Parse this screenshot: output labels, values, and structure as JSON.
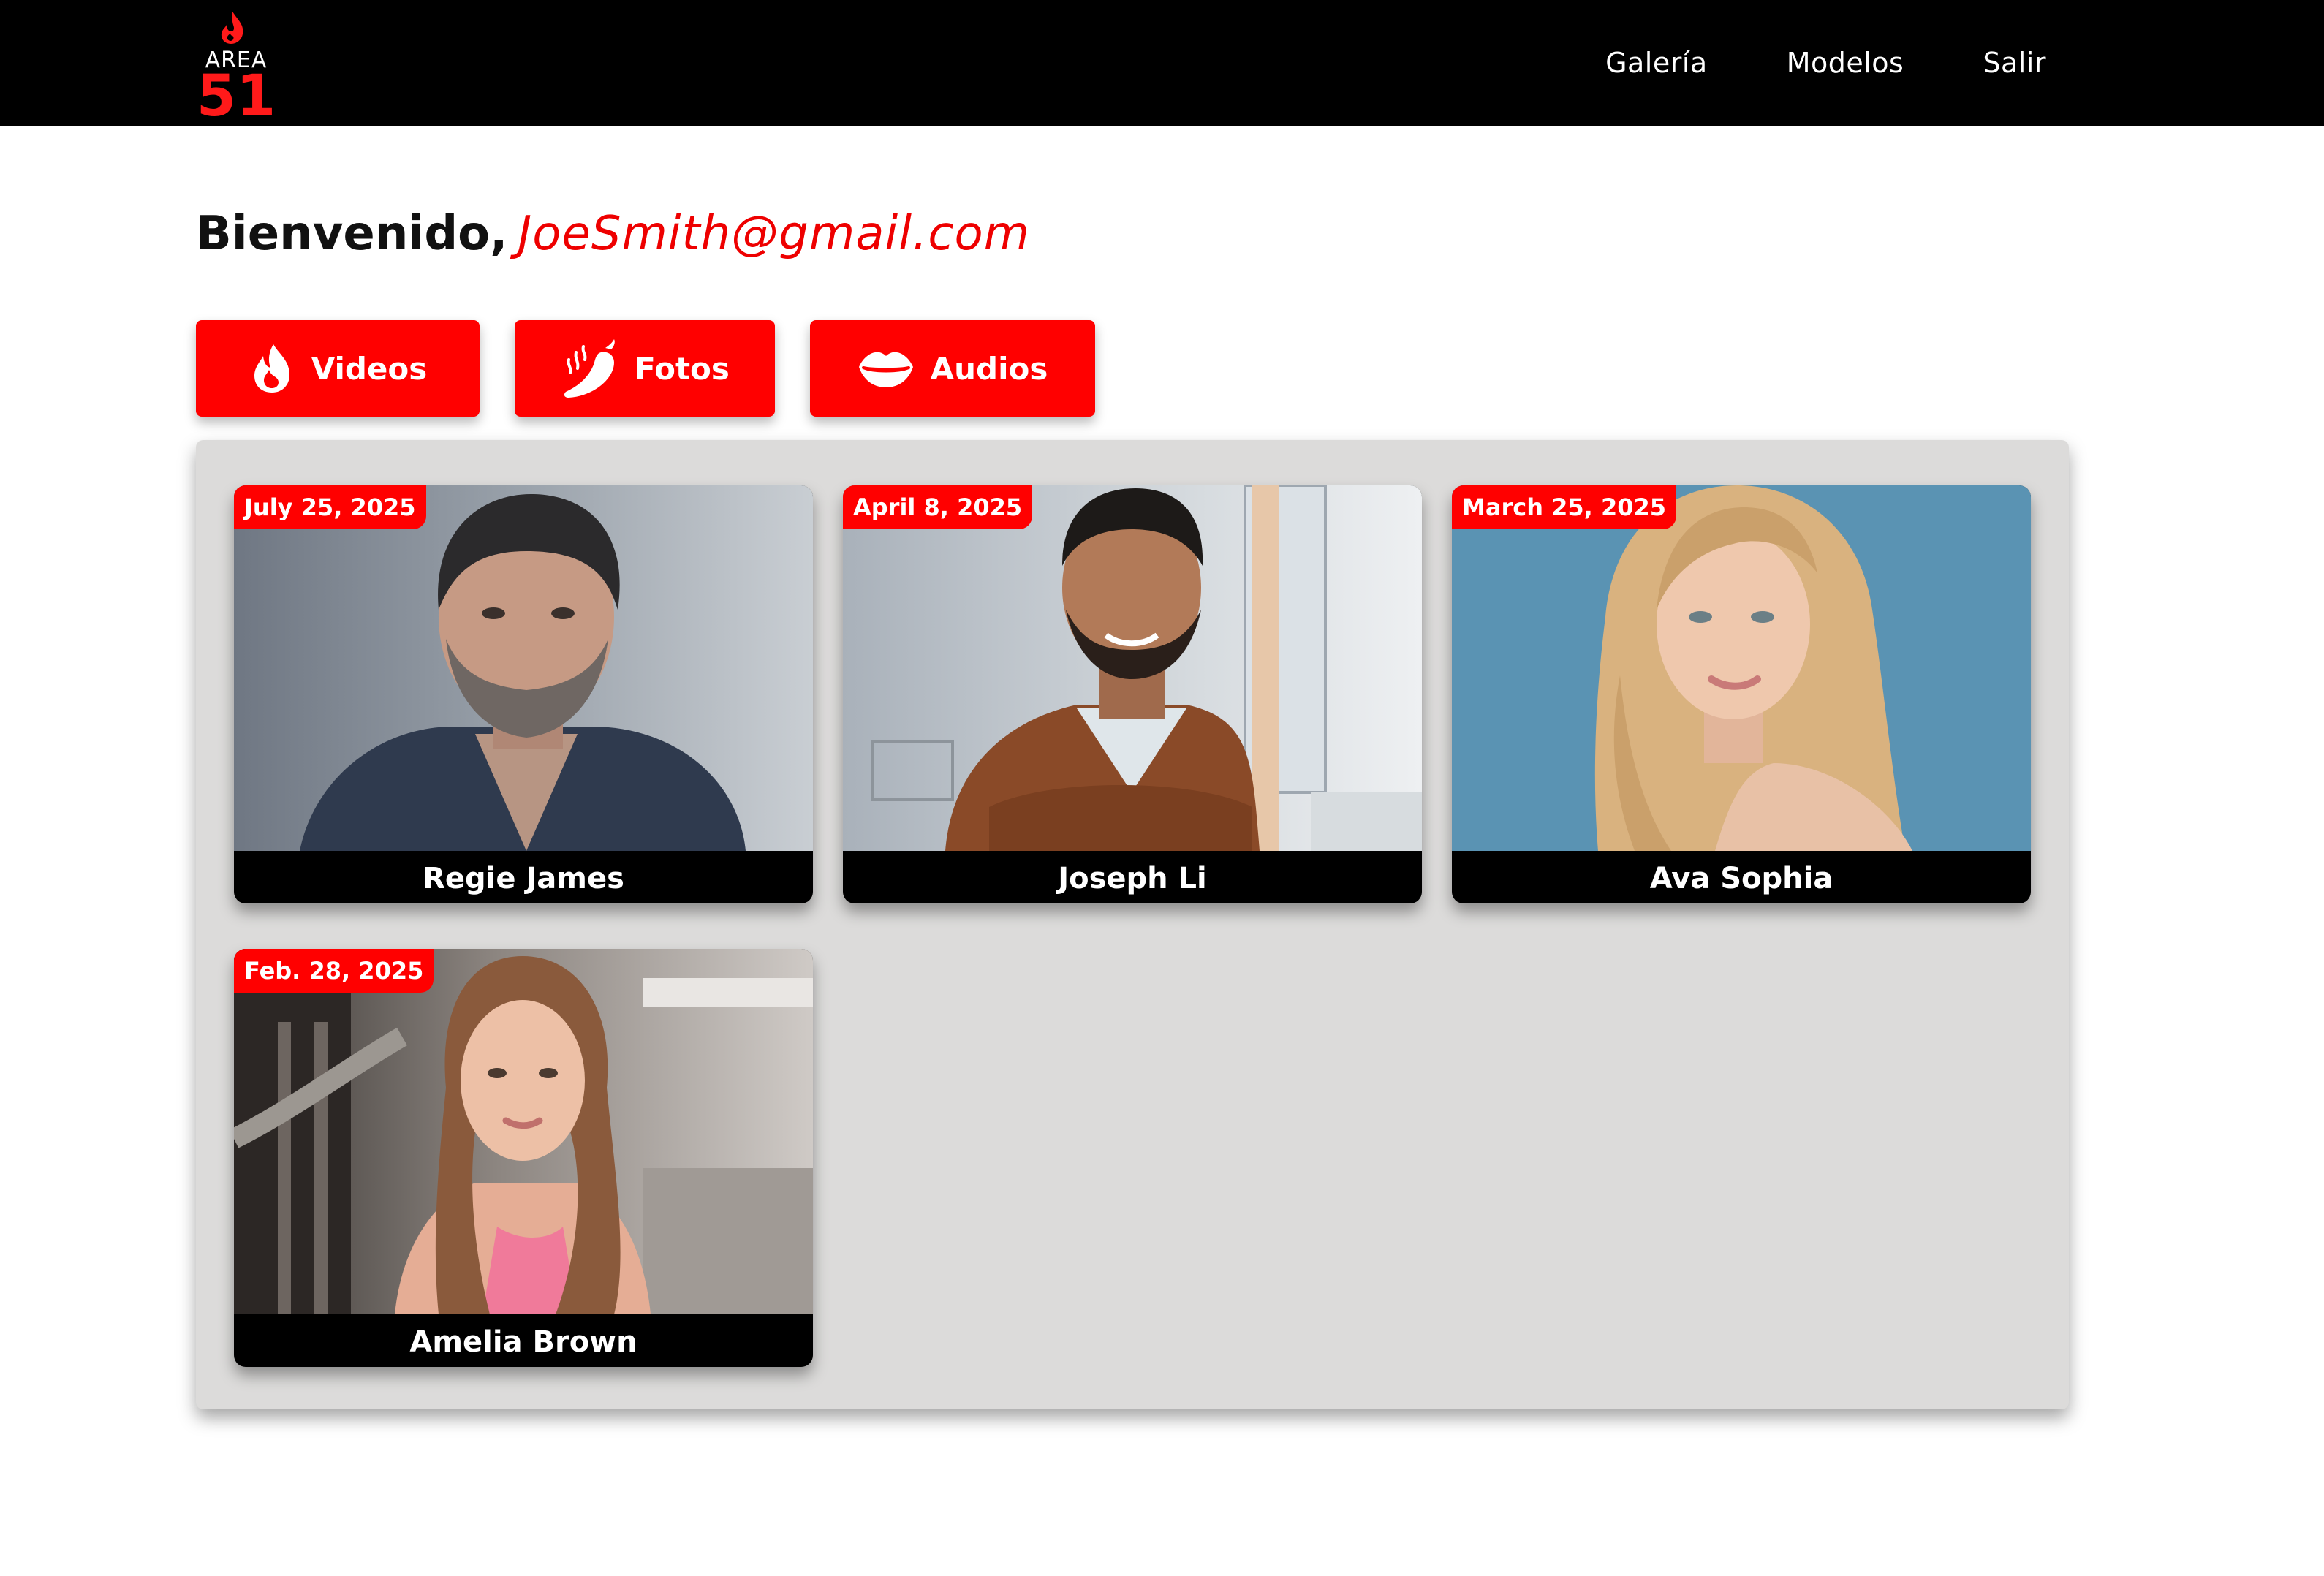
{
  "app": {
    "logo": {
      "icon": "flame-icon",
      "text_top": "AREA",
      "text_bottom": "51"
    },
    "nav": [
      {
        "label": "Galería"
      },
      {
        "label": "Modelos"
      },
      {
        "label": "Salir"
      }
    ]
  },
  "welcome": {
    "label": "Bienvenido,",
    "email": "JoeSmith@gmail.com"
  },
  "categories": [
    {
      "label": "Videos",
      "icon": "flame-icon"
    },
    {
      "label": "Fotos",
      "icon": "chili-pepper-icon"
    },
    {
      "label": "Audios",
      "icon": "lips-icon"
    }
  ],
  "models": [
    {
      "name": "Regie James",
      "date": "July 25, 2025"
    },
    {
      "name": "Joseph Li",
      "date": "April 8, 2025"
    },
    {
      "name": "Ava Sophia",
      "date": "March 25, 2025"
    },
    {
      "name": "Amelia Brown",
      "date": "Feb. 28, 2025"
    }
  ],
  "colors": {
    "accent": "#ff0000",
    "header_bg": "#000000",
    "panel_bg": "#dcdbda"
  }
}
